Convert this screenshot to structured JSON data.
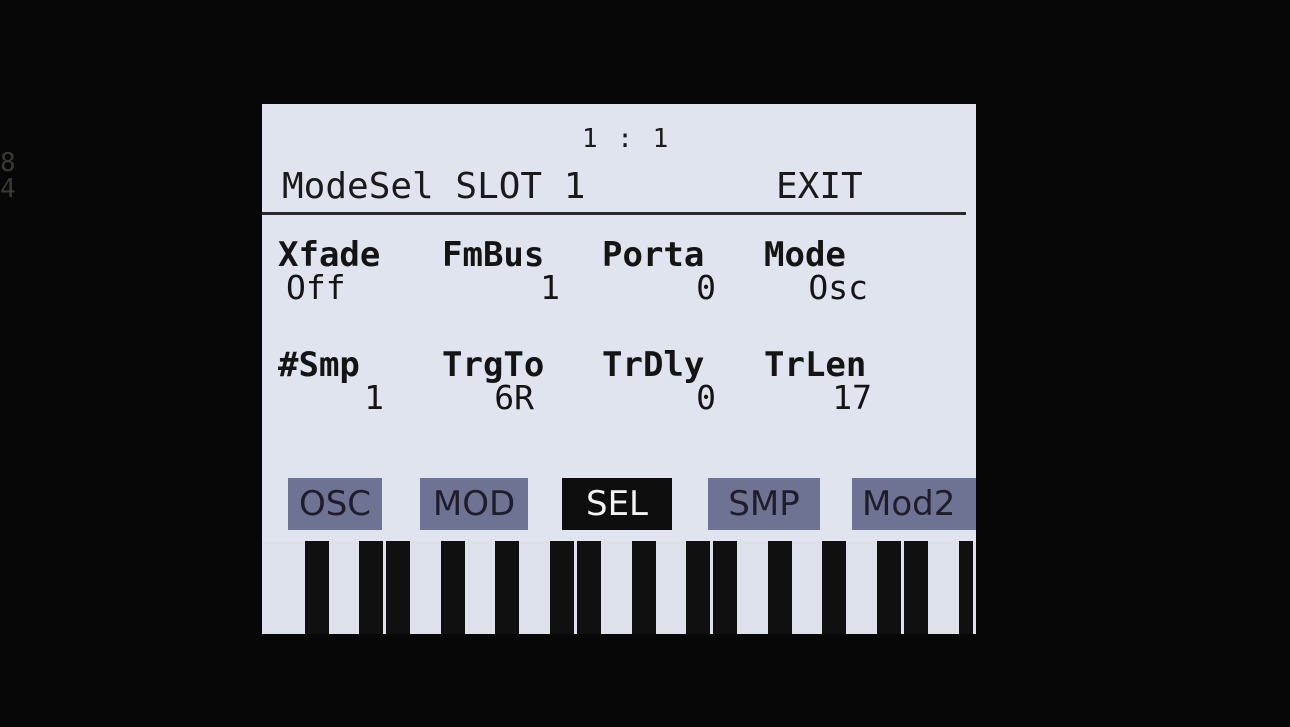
{
  "device": {
    "edge_glyph": "8\n4"
  },
  "header": {
    "position": "1 :  1",
    "title": "ModeSel SLOT 1",
    "exit_label": "EXIT"
  },
  "params": [
    {
      "name": "Xfade",
      "value": "Off"
    },
    {
      "name": "FmBus",
      "value": "1"
    },
    {
      "name": "Porta",
      "value": "0"
    },
    {
      "name": "Mode",
      "value": "Osc"
    },
    {
      "name": "#Smp",
      "value": "1"
    },
    {
      "name": "TrgTo",
      "value": "6R"
    },
    {
      "name": "TrDly",
      "value": "0"
    },
    {
      "name": "TrLen",
      "value": "17"
    }
  ],
  "tabs": [
    {
      "label": "OSC",
      "active": false
    },
    {
      "label": "MOD",
      "active": false
    },
    {
      "label": "SEL",
      "active": true
    },
    {
      "label": "SMP",
      "active": false
    },
    {
      "label": "Mod2",
      "active": false
    }
  ],
  "colors": {
    "screen_bg": "#dfe4ee",
    "tab_inactive": "#6f7393",
    "tab_active": "#0e0e0e",
    "bezel": "#070708"
  }
}
